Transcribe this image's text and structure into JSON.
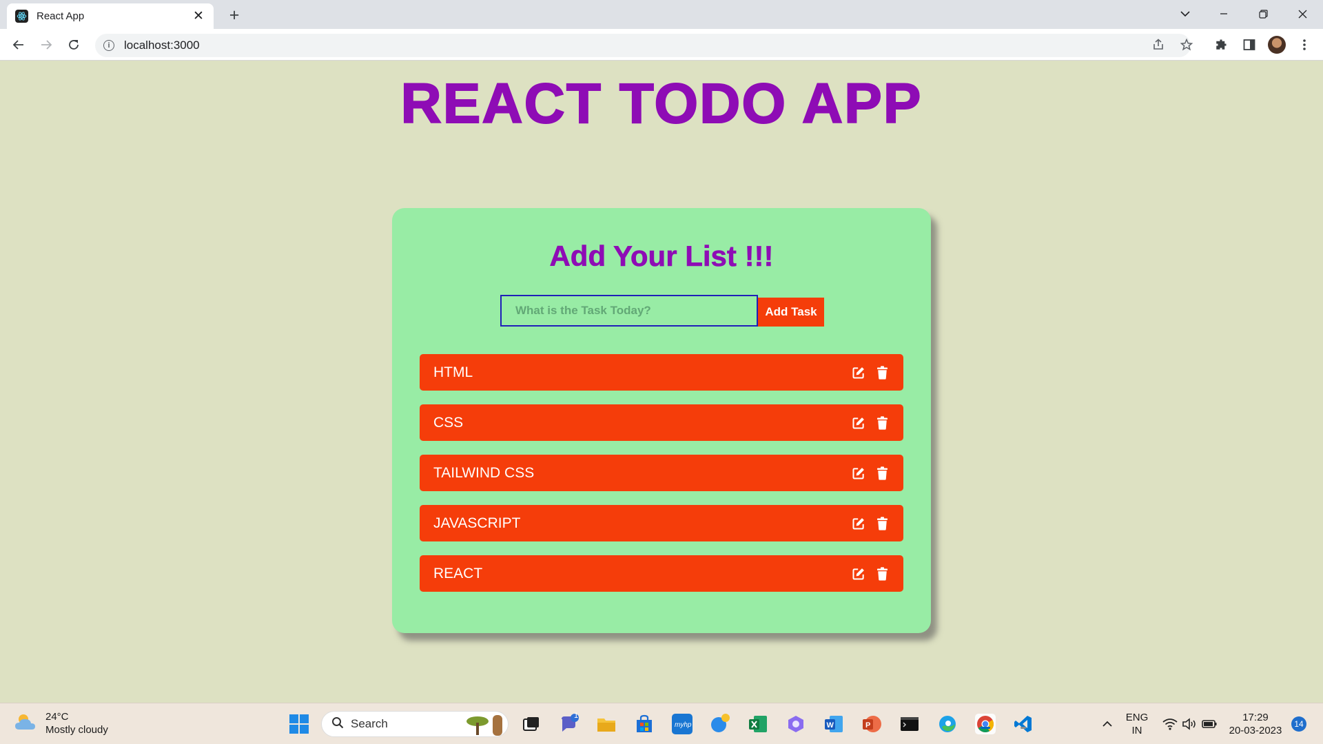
{
  "browser": {
    "tab_title": "React App",
    "tab_close": "✕",
    "new_tab": "+",
    "url": "localhost:3000",
    "accent": "#8e0cb5"
  },
  "app": {
    "title": "REACT TODO APP",
    "card_title": "Add Your List !!!",
    "input_placeholder": "What is the Task Today?",
    "input_value": "",
    "add_button": "Add Task",
    "item_color": "#f53d0a",
    "card_color": "#98eca5",
    "todos": [
      {
        "text": "HTML"
      },
      {
        "text": "CSS"
      },
      {
        "text": "TAILWIND CSS"
      },
      {
        "text": "JAVASCRIPT"
      },
      {
        "text": "REACT"
      }
    ]
  },
  "taskbar": {
    "weather_temp": "24°C",
    "weather_desc": "Mostly cloudy",
    "search_label": "Search",
    "teams_badge": "1",
    "lang_1": "ENG",
    "lang_2": "IN",
    "time": "17:29",
    "date": "20-03-2023",
    "notification_count": "14"
  }
}
